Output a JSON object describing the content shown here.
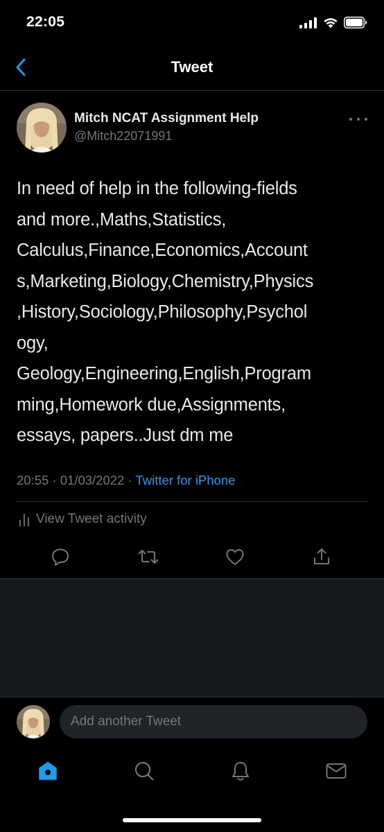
{
  "status_bar": {
    "time": "22:05"
  },
  "header": {
    "title": "Tweet"
  },
  "tweet": {
    "author_name": "Mitch NCAT Assignment Help",
    "author_handle": "@Mitch22071991",
    "text": "In need of help in the following-fields\nand more.,Maths,Statistics,\nCalculus,Finance,Economics,Account\ns,Marketing,Biology,Chemistry,Physics\n,History,Sociology,Philosophy,Psychol\nogy,\nGeology,Engineering,English,Program\nming,Homework due,Assignments,\nessays, papers..Just dm me",
    "time": "20:55",
    "date": "01/03/2022",
    "separator": "·",
    "source": "Twitter for iPhone",
    "activity_label": "View Tweet activity"
  },
  "reply": {
    "placeholder": "Add another Tweet"
  },
  "icons": {
    "back": "chevron-left-icon",
    "more": "more-horizontal-icon",
    "activity": "bar-chart-icon",
    "reply": "reply-icon",
    "retweet": "retweet-icon",
    "like": "heart-icon",
    "share": "share-icon",
    "home": "home-icon",
    "search": "search-icon",
    "notifications": "bell-icon",
    "messages": "mail-icon"
  },
  "colors": {
    "accent": "#1d9bf0",
    "background": "#000000",
    "muted": "#71767b",
    "panel": "#15181c"
  }
}
